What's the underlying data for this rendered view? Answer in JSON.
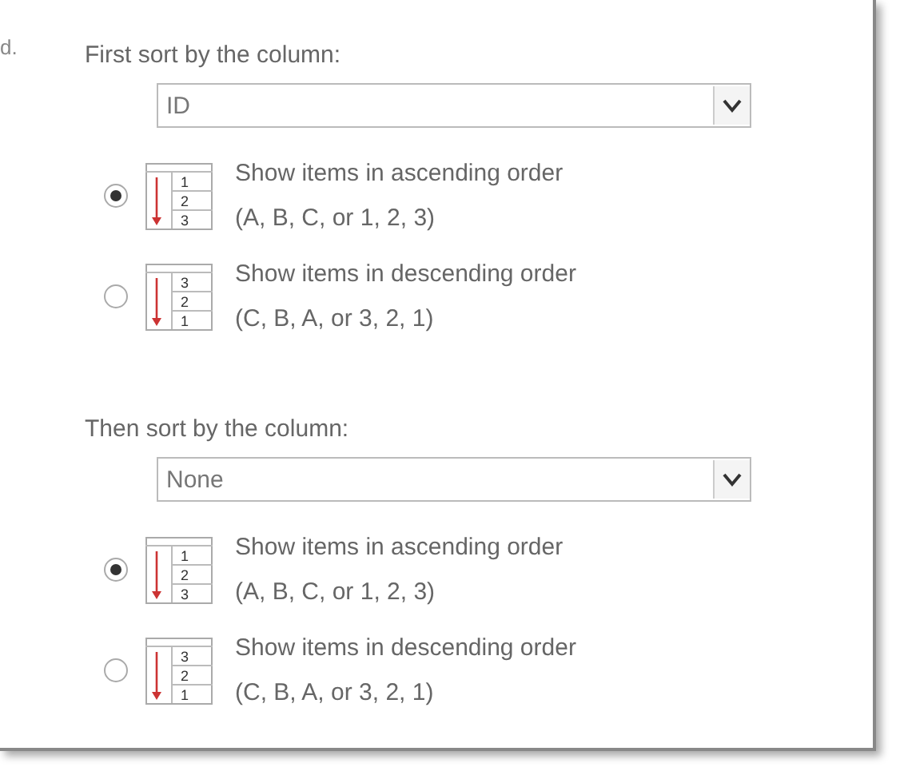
{
  "edge_text": "d.",
  "sections": [
    {
      "label": "First sort by the column:",
      "dropdown": {
        "value": "ID"
      },
      "options": [
        {
          "selected": true,
          "digits": [
            "1",
            "2",
            "3"
          ],
          "title": "Show items in ascending order",
          "example": "(A, B, C, or 1, 2, 3)"
        },
        {
          "selected": false,
          "digits": [
            "3",
            "2",
            "1"
          ],
          "title": "Show items in descending order",
          "example": "(C, B, A, or 3, 2, 1)"
        }
      ]
    },
    {
      "label": "Then sort by the column:",
      "dropdown": {
        "value": "None"
      },
      "options": [
        {
          "selected": true,
          "digits": [
            "1",
            "2",
            "3"
          ],
          "title": "Show items in ascending order",
          "example": "(A, B, C, or 1, 2, 3)"
        },
        {
          "selected": false,
          "digits": [
            "3",
            "2",
            "1"
          ],
          "title": "Show items in descending order",
          "example": "(C, B, A, or 3, 2, 1)"
        }
      ]
    }
  ]
}
